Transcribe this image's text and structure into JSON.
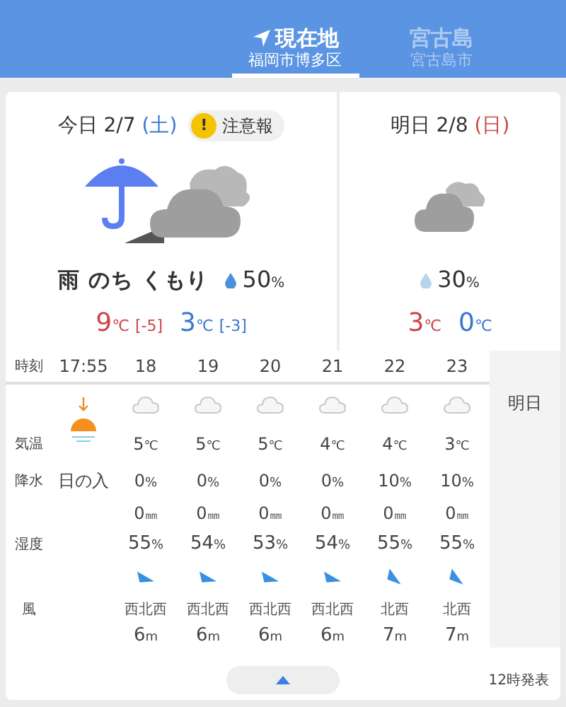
{
  "header": {
    "tabs": [
      {
        "kind": "location",
        "title": "現在地",
        "subtitle": "福岡市博多区",
        "selected": true
      },
      {
        "kind": "place",
        "title": "宮古島",
        "subtitle": "宮古島市",
        "selected": false
      }
    ]
  },
  "days": [
    {
      "kind": "today",
      "label": "今日",
      "date": "2/7",
      "weekday": "(土)",
      "color": "#3b78d0",
      "alert": {
        "mark": "!",
        "text": "注意報"
      },
      "weather": "雨 のち くもり",
      "pop": "50",
      "pop_unit": "%",
      "high": "9",
      "high_unit": "℃",
      "high_diff": "[-5]",
      "low": "3",
      "low_unit": "℃",
      "low_diff": "[-3]"
    },
    {
      "kind": "tomorrow",
      "label": "明日",
      "date": "2/8",
      "weekday": "(日)",
      "color": "#c94a4a",
      "pop": "30",
      "pop_unit": "%",
      "high": "3",
      "high_unit": "℃",
      "low": "0",
      "low_unit": "℃"
    }
  ],
  "hourly": {
    "labels": {
      "time": "時刻",
      "temp": "気温",
      "precip": "降水",
      "humidity": "湿度",
      "wind": "風"
    },
    "next_day": "明日",
    "columns": [
      {
        "kind": "sunset",
        "time": "17:55",
        "label": "日の入"
      },
      {
        "kind": "hour",
        "time": "18",
        "temp": "5",
        "temp_unit": "℃",
        "precip": "0",
        "precip_unit": "%",
        "rain": "0",
        "rain_unit": "㎜",
        "humidity": "55",
        "humidity_unit": "%",
        "arrow": {
          "kind": "ese"
        },
        "wind_dir": "西北西",
        "wind_speed": "6",
        "wind_unit": "m"
      },
      {
        "kind": "hour",
        "time": "19",
        "temp": "5",
        "temp_unit": "℃",
        "precip": "0",
        "precip_unit": "%",
        "rain": "0",
        "rain_unit": "㎜",
        "humidity": "54",
        "humidity_unit": "%",
        "arrow": {
          "kind": "ese"
        },
        "wind_dir": "西北西",
        "wind_speed": "6",
        "wind_unit": "m"
      },
      {
        "kind": "hour",
        "time": "20",
        "temp": "5",
        "temp_unit": "℃",
        "precip": "0",
        "precip_unit": "%",
        "rain": "0",
        "rain_unit": "㎜",
        "humidity": "53",
        "humidity_unit": "%",
        "arrow": {
          "kind": "ese"
        },
        "wind_dir": "西北西",
        "wind_speed": "6",
        "wind_unit": "m"
      },
      {
        "kind": "hour",
        "time": "21",
        "temp": "4",
        "temp_unit": "℃",
        "precip": "0",
        "precip_unit": "%",
        "rain": "0",
        "rain_unit": "㎜",
        "humidity": "54",
        "humidity_unit": "%",
        "arrow": {
          "kind": "ese"
        },
        "wind_dir": "西北西",
        "wind_speed": "6",
        "wind_unit": "m"
      },
      {
        "kind": "hour",
        "time": "22",
        "temp": "4",
        "temp_unit": "℃",
        "precip": "10",
        "precip_unit": "%",
        "rain": "0",
        "rain_unit": "㎜",
        "humidity": "55",
        "humidity_unit": "%",
        "arrow": {
          "kind": "se"
        },
        "wind_dir": "北西",
        "wind_speed": "7",
        "wind_unit": "m"
      },
      {
        "kind": "hour",
        "time": "23",
        "temp": "3",
        "temp_unit": "℃",
        "precip": "10",
        "precip_unit": "%",
        "rain": "0",
        "rain_unit": "㎜",
        "humidity": "55",
        "humidity_unit": "%",
        "arrow": {
          "kind": "se"
        },
        "wind_dir": "北西",
        "wind_speed": "7",
        "wind_unit": "m"
      }
    ]
  },
  "footer": {
    "issued": "12時発表"
  }
}
